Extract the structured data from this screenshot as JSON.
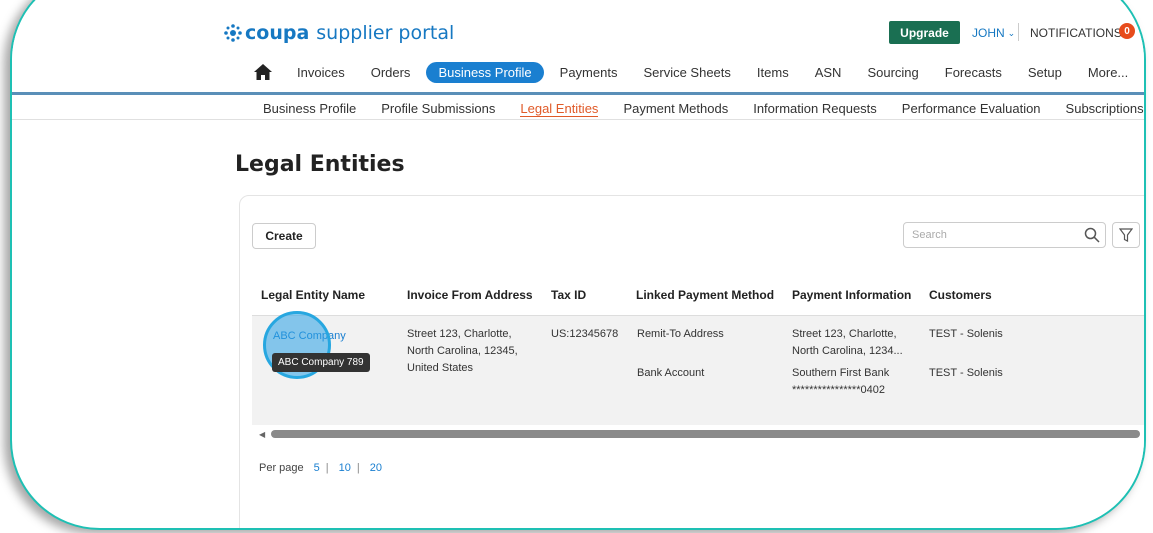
{
  "header": {
    "logo_brand": "coupa",
    "logo_sub": "supplier portal",
    "upgrade_label": "Upgrade",
    "user_label": "JOHN",
    "notifications_label": "NOTIFICATIONS",
    "notifications_count": "0"
  },
  "main_nav": {
    "items": [
      {
        "label": "Invoices"
      },
      {
        "label": "Orders"
      },
      {
        "label": "Business Profile",
        "active": true
      },
      {
        "label": "Payments"
      },
      {
        "label": "Service Sheets"
      },
      {
        "label": "Items"
      },
      {
        "label": "ASN"
      },
      {
        "label": "Sourcing"
      },
      {
        "label": "Forecasts"
      },
      {
        "label": "Setup"
      },
      {
        "label": "More..."
      }
    ]
  },
  "sub_nav": {
    "items": [
      {
        "label": "Business Profile"
      },
      {
        "label": "Profile Submissions"
      },
      {
        "label": "Legal Entities",
        "active": true
      },
      {
        "label": "Payment Methods"
      },
      {
        "label": "Information Requests"
      },
      {
        "label": "Performance Evaluation"
      },
      {
        "label": "Subscriptions"
      }
    ]
  },
  "page": {
    "title": "Legal Entities",
    "create_label": "Create",
    "search_placeholder": "Search"
  },
  "table": {
    "columns": [
      "Legal Entity Name",
      "Invoice From Address",
      "Tax ID",
      "Linked Payment Method",
      "Payment Information",
      "Customers"
    ],
    "row": {
      "entity_name": "ABC Company",
      "tooltip": "ABC Company 789",
      "address_lines": [
        "Street 123, Charlotte,",
        "North Carolina, 12345,",
        "United States"
      ],
      "tax_id": "US:12345678",
      "payment_methods": [
        "Remit-To Address",
        "Bank Account"
      ],
      "payment_info_1": [
        "Street 123, Charlotte,",
        "North Carolina, 1234..."
      ],
      "payment_info_2": [
        "Southern First Bank",
        "****************0402"
      ],
      "customers": [
        "TEST - Solenis",
        "TEST - Solenis"
      ]
    }
  },
  "paging": {
    "label": "Per page",
    "options": [
      "5",
      "10",
      "20"
    ]
  },
  "colors": {
    "brand_blue": "#1678c2",
    "upgrade_green": "#1a6f52",
    "active_tab": "#1a7fd0",
    "sub_active": "#e05a28",
    "frame_teal": "#1ec0b4"
  }
}
